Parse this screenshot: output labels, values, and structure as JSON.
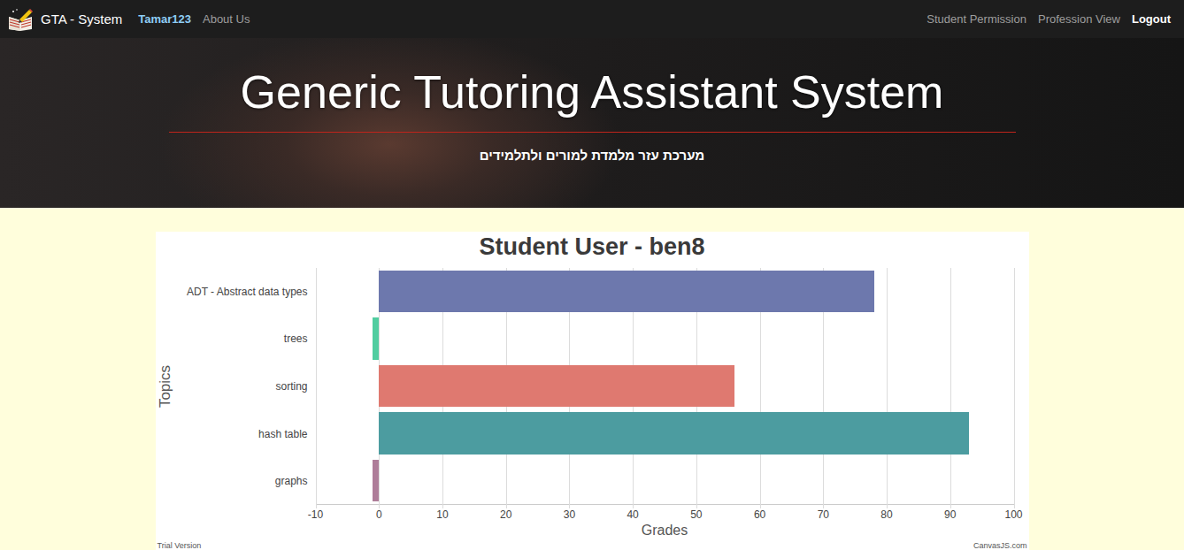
{
  "nav": {
    "brand": "GTA - System",
    "user": "Tamar123",
    "left_links": [
      "About Us"
    ],
    "right_links": [
      {
        "label": "Student Permission",
        "highlighted": false
      },
      {
        "label": "Profession View",
        "highlighted": false
      },
      {
        "label": "Logout",
        "highlighted": true
      }
    ]
  },
  "hero": {
    "title": "Generic Tutoring Assistant System",
    "subtitle": "מערכת עזר מלמדת למורים ולתלמידים"
  },
  "chart": {
    "title": "Student User - ben8",
    "y_axis_title": "Topics",
    "x_axis_title": "Grades",
    "ticks": [
      "-10",
      "0",
      "10",
      "20",
      "30",
      "40",
      "50",
      "60",
      "70",
      "80",
      "90",
      "100"
    ],
    "bars": [
      {
        "label": "ADT - Abstract data types",
        "value": 78,
        "color": "#6d78ad"
      },
      {
        "label": "trees",
        "value": -1,
        "color": "#51cda0"
      },
      {
        "label": "sorting",
        "value": 56,
        "color": "#df7970"
      },
      {
        "label": "hash table",
        "value": 93,
        "color": "#4c9ca0"
      },
      {
        "label": "graphs",
        "value": -1,
        "color": "#ae7d99"
      }
    ],
    "credits": [
      "Trial Version",
      "CanvasJS.com"
    ]
  }
}
